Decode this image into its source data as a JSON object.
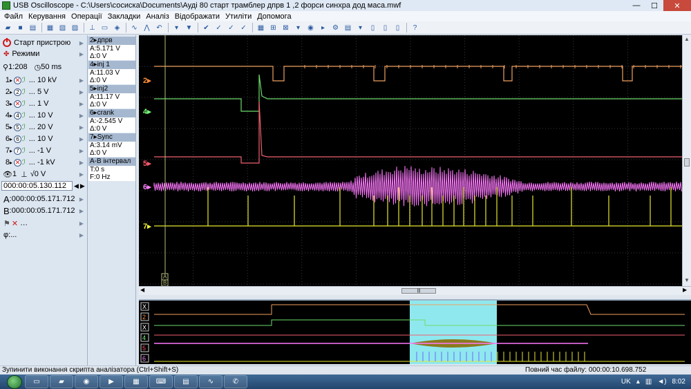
{
  "window": {
    "title": "USB Oscilloscope - C:\\Users\\сосиска\\Documents\\Ауді 80 старт трамблер дпрв 1 ,2 форси синхра дод маса.mwf",
    "buttons": {
      "minimize": "—",
      "maximize": "☐",
      "close": "✕"
    }
  },
  "menu": [
    "Файл",
    "Керування",
    "Операції",
    "Закладки",
    "Аналіз",
    "Відображати",
    "Утиліти",
    "Допомога"
  ],
  "left_panel": {
    "start_label": "Старт пристрою",
    "modes_label": "Режими",
    "zoom": "1:208",
    "timebase": "50 ms",
    "channels": [
      {
        "num": "1",
        "circle": "",
        "value": "... 10 kV"
      },
      {
        "num": "2",
        "circle": "2",
        "value": "... 5 V"
      },
      {
        "num": "3",
        "circle": "",
        "value": "... 1 V"
      },
      {
        "num": "4",
        "circle": "4",
        "value": "... 10 V"
      },
      {
        "num": "5",
        "circle": "5",
        "value": "... 20 V"
      },
      {
        "num": "6",
        "circle": "6",
        "value": "... 10 V"
      },
      {
        "num": "7",
        "circle": "7",
        "value": "... -1 V"
      },
      {
        "num": "8",
        "circle": "",
        "value": "... -1 kV"
      }
    ],
    "trigger_channel": "1",
    "trigger_level": "0 V",
    "position": "000:00:05.130.112",
    "cursor_a_label": "A",
    "cursor_a": ":000:00:05.171.712",
    "cursor_b_label": "B",
    "cursor_b": ":000:00:05.171.712",
    "phi": "φ:..."
  },
  "info_panel": [
    {
      "head": "2▸дпрв",
      "a": "A:5.171 V",
      "d": "Δ:0 V"
    },
    {
      "head": "4▸inj 1",
      "a": "A:11.03 V",
      "d": "Δ:0 V"
    },
    {
      "head": "5▸inj2",
      "a": "A:11.17 V",
      "d": "Δ:0 V"
    },
    {
      "head": "6▸crank",
      "a": "A:-2.545 V",
      "d": "Δ:0 V"
    },
    {
      "head": "7▸Sync",
      "a": "A:3.14 mV",
      "d": "Δ:0 V"
    },
    {
      "head": "A-B інтервал",
      "a": "T:0 s",
      "d": "F:0 Hz"
    }
  ],
  "scope": {
    "channel_markers": [
      {
        "label": "2",
        "color": "#ff8c3c"
      },
      {
        "label": "4",
        "color": "#7cff7c"
      },
      {
        "label": "5",
        "color": "#ff5a6e"
      },
      {
        "label": "6",
        "color": "#ff80ff"
      },
      {
        "label": "7",
        "color": "#f0f03c"
      }
    ],
    "cursor_labels": [
      "A",
      "B"
    ],
    "trace_colors": {
      "ch2": "#f0a060",
      "ch4": "#6cdc6c",
      "ch5": "#f06070",
      "ch6": "#ff78ff",
      "ch7": "#e8e830",
      "grid": "#3a3a3a"
    }
  },
  "overview": {
    "labels": [
      "X",
      "2",
      "X",
      "4",
      "5",
      "6"
    ],
    "window_color": "#8fe8ee"
  },
  "status": {
    "left": "Зупинити виконання скрипта аналізатора (Ctrl+Shift+S)",
    "right": "Повний час файлу: 000:00:10.698.752"
  },
  "taskbar": {
    "lang": "UK",
    "time": "8:02"
  }
}
